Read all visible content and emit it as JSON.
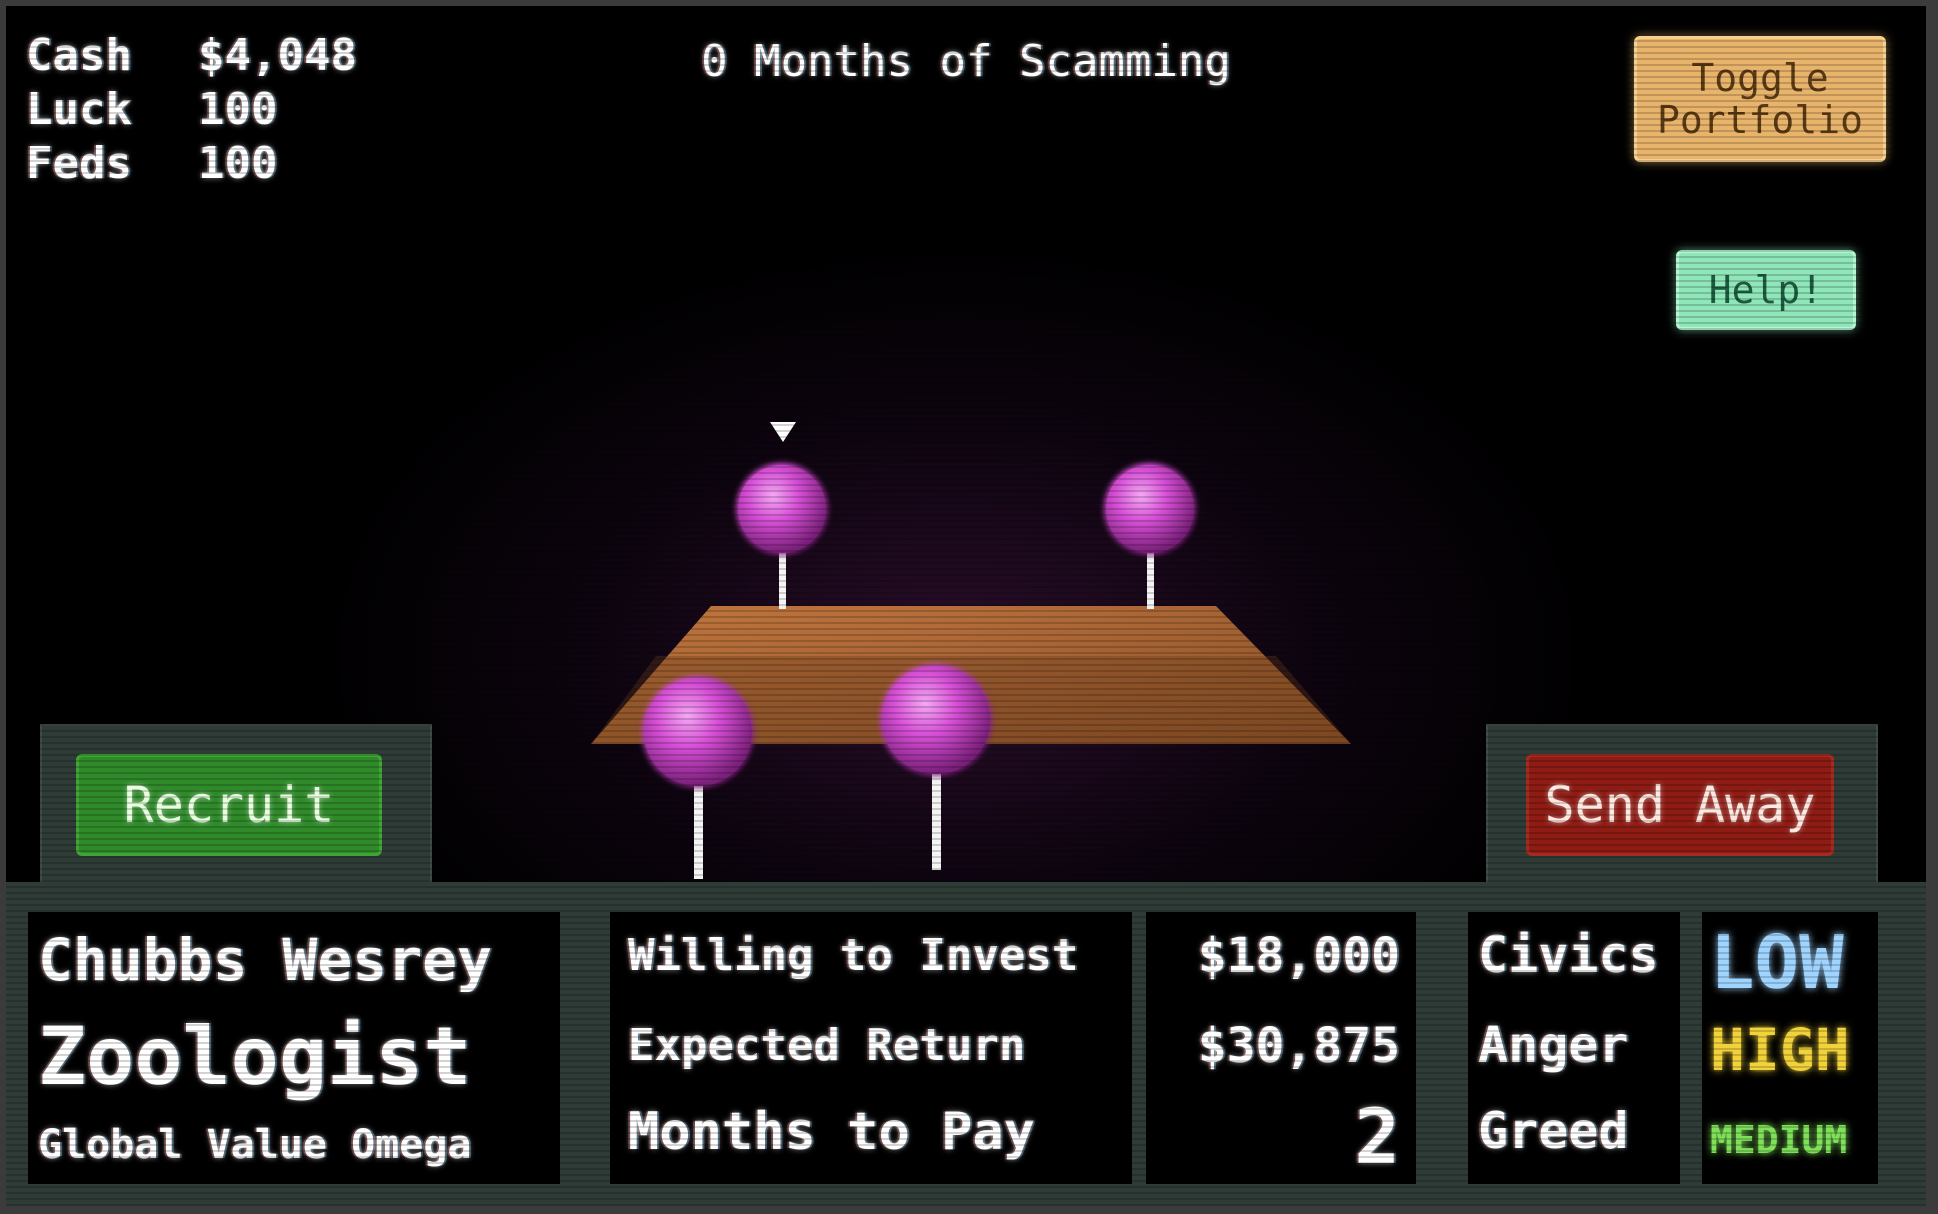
{
  "stats": {
    "cash_label": "Cash",
    "cash_value": "$4,048",
    "luck_label": "Luck",
    "luck_value": "100",
    "feds_label": "Feds",
    "feds_value": "100"
  },
  "title": "0 Months of Scamming",
  "buttons": {
    "toggle_portfolio_line1": "Toggle",
    "toggle_portfolio_line2": "Portfolio",
    "help": "Help!",
    "recruit": "Recruit",
    "send_away": "Send Away"
  },
  "investor": {
    "name": "Chubbs Wesrey",
    "job": "Zoologist",
    "company": "Global Value Omega"
  },
  "terms": [
    {
      "label": "Willing to Invest",
      "value": "$18,000"
    },
    {
      "label": "Expected Return",
      "value": "$30,875"
    },
    {
      "label": "Months to Pay",
      "value": "2"
    }
  ],
  "traits": [
    {
      "label": "Civics",
      "level": "LOW",
      "color": "#9fd4ff"
    },
    {
      "label": "Anger",
      "level": "HIGH",
      "color": "#f2d23a"
    },
    {
      "label": "Greed",
      "level": "MEDIUM",
      "color": "#7fe05a"
    }
  ],
  "scene": {
    "pin_color": "#d64fd6",
    "platform_color": "#c9793a",
    "icons": [
      "selector-arrow-icon",
      "pin-icon"
    ]
  }
}
